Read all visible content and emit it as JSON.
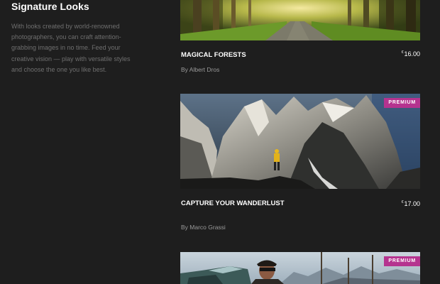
{
  "intro": {
    "title": "Signature Looks",
    "description": "With looks created by world-renowned photographers, you can craft attention-grabbing images in no time. Feed your creative vision — play with versatile styles and choose the one you like best."
  },
  "cards": [
    {
      "title": "MAGICAL FORESTS",
      "currency": "€",
      "price": "16.00",
      "author": "By Albert Dros",
      "badge": ""
    },
    {
      "title": "CAPTURE YOUR WANDERLUST",
      "currency": "€",
      "price": "17.00",
      "author": "By Marco Grassi",
      "badge": "PREMIUM"
    },
    {
      "title": "",
      "currency": "",
      "price": "",
      "author": "",
      "badge": "PREMIUM"
    }
  ],
  "colors": {
    "background": "#1e1e1e",
    "badge": "#b5338f",
    "intro_text": "#6f6f6f"
  }
}
